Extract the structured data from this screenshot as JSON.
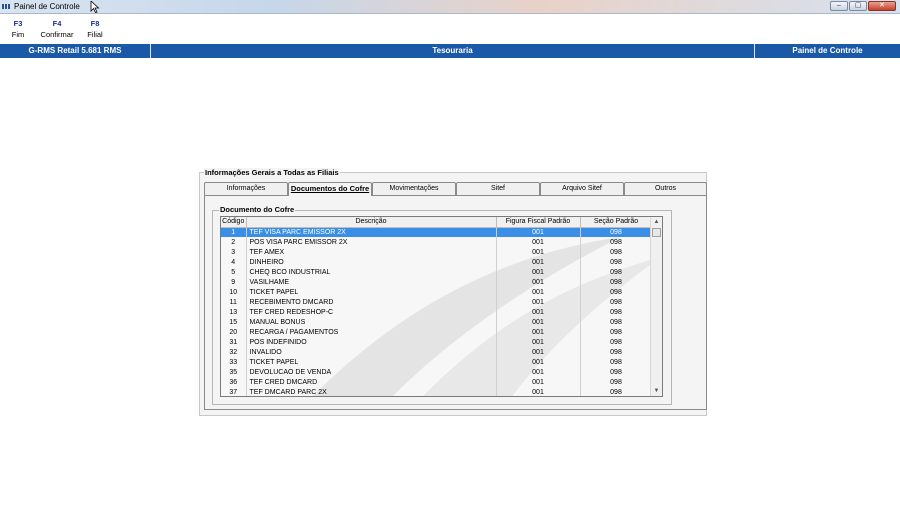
{
  "window": {
    "title": "Painel de Controle",
    "minimize": "–",
    "maximize": "▢",
    "close": "✕"
  },
  "function_keys": [
    {
      "key": "F3",
      "label": "Fim"
    },
    {
      "key": "F4",
      "label": "Confirmar"
    },
    {
      "key": "F8",
      "label": "Filial"
    }
  ],
  "header": {
    "left": "G-RMS Retail 5.681 RMS",
    "center": "Tesouraria",
    "right": "Painel de Controle"
  },
  "group_title": "Informações Gerais a Todas as Filiais",
  "tabs": [
    {
      "label": "Informações"
    },
    {
      "label": "Documentos do Cofre",
      "active": true
    },
    {
      "label": "Movimentações"
    },
    {
      "label": "Sitef"
    },
    {
      "label": "Arquivo Sitef"
    },
    {
      "label": "Outros"
    }
  ],
  "inner_group_title": "Documento do Cofre",
  "grid": {
    "columns": [
      "Código",
      "Descrição",
      "Figura Fiscal Padrão",
      "Seção Padrão"
    ],
    "rows": [
      [
        "1",
        "TEF VISA PARC EMISSOR 2X",
        "001",
        "098"
      ],
      [
        "2",
        "POS VISA PARC EMISSOR  2X",
        "001",
        "098"
      ],
      [
        "3",
        "TEF AMEX",
        "001",
        "098"
      ],
      [
        "4",
        "DINHEIRO",
        "001",
        "098"
      ],
      [
        "5",
        "CHEQ BCO INDUSTRIAL",
        "001",
        "098"
      ],
      [
        "9",
        "VASILHAME",
        "001",
        "098"
      ],
      [
        "10",
        "TICKET PAPEL",
        "001",
        "098"
      ],
      [
        "11",
        "RECEBIMENTO DMCARD",
        "001",
        "098"
      ],
      [
        "13",
        "TEF CRED REDESHOP-C",
        "001",
        "098"
      ],
      [
        "15",
        "MANUAL BONUS",
        "001",
        "098"
      ],
      [
        "20",
        "RECARGA / PAGAMENTOS",
        "001",
        "098"
      ],
      [
        "31",
        "POS INDEFINIDO",
        "001",
        "098"
      ],
      [
        "32",
        "INVALIDO",
        "001",
        "098"
      ],
      [
        "33",
        "TICKET PAPEL",
        "001",
        "098"
      ],
      [
        "35",
        "DEVOLUCAO DE VENDA",
        "001",
        "098"
      ],
      [
        "36",
        "TEF CRED DMCARD",
        "001",
        "098"
      ],
      [
        "37",
        "TEF DMCARD PARC 2X",
        "001",
        "098"
      ]
    ],
    "selected_row": 0
  },
  "scroll": {
    "up": "▲",
    "down": "▼"
  }
}
